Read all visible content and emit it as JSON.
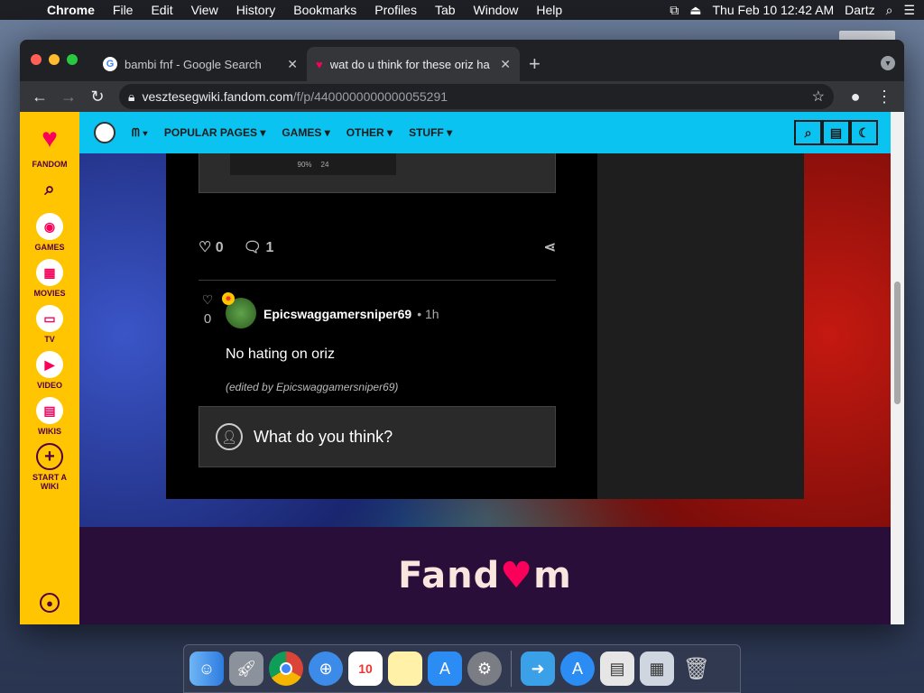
{
  "menubar": {
    "app": "Chrome",
    "items": [
      "File",
      "Edit",
      "View",
      "History",
      "Bookmarks",
      "Profiles",
      "Tab",
      "Window",
      "Help"
    ],
    "clock": "Thu Feb 10  12:42 AM",
    "user": "Dartz"
  },
  "browser": {
    "tabs": [
      {
        "title": "bambi fnf - Google Search",
        "icon": "google-icon"
      },
      {
        "title": "wat do u think for these oriz ha",
        "icon": "fandom-icon"
      }
    ],
    "url_domain": "vesztesegwiki.fandom.com",
    "url_path": "/f/p/4400000000000055291"
  },
  "fandom_rail": {
    "brand": "FANDOM",
    "items": [
      "GAMES",
      "MOVIES",
      "TV",
      "VIDEO",
      "WIKIS",
      "START A WIKI"
    ]
  },
  "wiki_nav": {
    "items": [
      "POPULAR PAGES",
      "GAMES",
      "OTHER",
      "STUFF"
    ]
  },
  "post": {
    "embed_stats": [
      "90%",
      "24"
    ],
    "likes": "0",
    "replies": "1"
  },
  "reply": {
    "likes": "0",
    "author": "Epicswaggamersniper69",
    "time": "• 1h",
    "body": "No hating on oriz",
    "edited": "(edited by Epicswaggamersniper69)"
  },
  "comment_box": {
    "placeholder": "What do you think?"
  },
  "footer": {
    "logo_pre": "Fand",
    "logo_post": "m"
  }
}
